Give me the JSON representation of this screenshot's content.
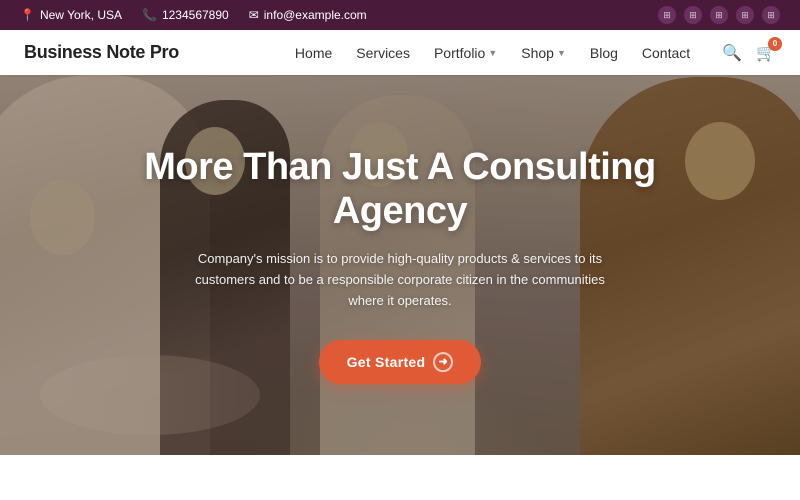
{
  "topbar": {
    "location": "New York, USA",
    "phone": "1234567890",
    "email": "info@example.com",
    "wp_icons": [
      "W",
      "W",
      "W",
      "W",
      "W"
    ]
  },
  "header": {
    "logo": "Business Note Pro",
    "nav": [
      {
        "label": "Home",
        "dropdown": false
      },
      {
        "label": "Services",
        "dropdown": false
      },
      {
        "label": "Portfolio",
        "dropdown": true
      },
      {
        "label": "Shop",
        "dropdown": true
      },
      {
        "label": "Blog",
        "dropdown": false
      },
      {
        "label": "Contact",
        "dropdown": false
      }
    ],
    "cart_count": "0"
  },
  "hero": {
    "title": "More Than Just A Consulting Agency",
    "subtitle": "Company's mission is to provide high-quality products & services to its customers and to be a responsible corporate citizen in the communities where it operates.",
    "cta_label": "Get Started"
  }
}
